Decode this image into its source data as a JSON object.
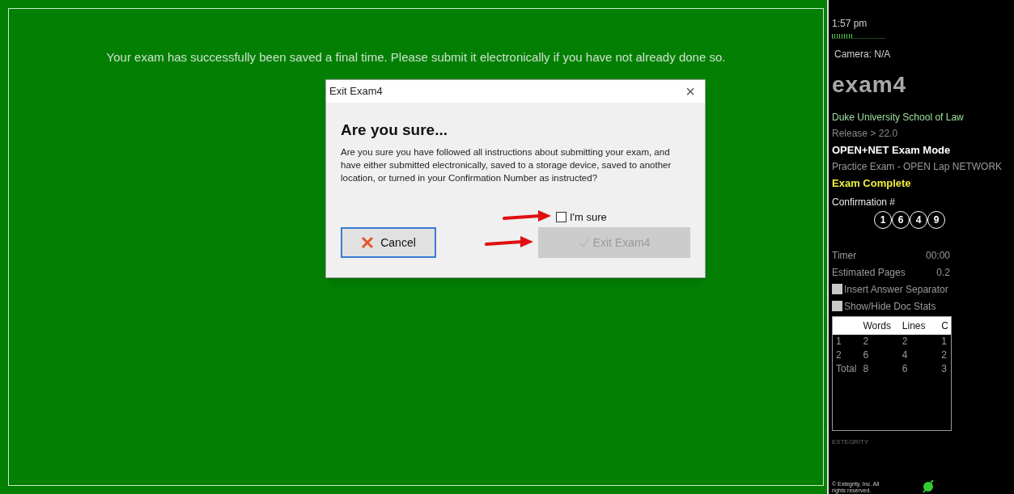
{
  "main": {
    "message": "Your exam has successfully been saved a final time. Please submit it electronically if you have not already done so."
  },
  "dialog": {
    "title": "Exit Exam4",
    "close": "×",
    "heading": "Are you sure...",
    "body": "Are you sure you have followed all instructions about submitting your exam, and have either submitted electronically, saved to a storage device, saved to another location, or turned in your Confirmation Number as instructed?",
    "confirm": {
      "label": "I'm sure",
      "checked": false
    },
    "buttons": [
      {
        "kind": "cancel",
        "label": "Cancel"
      },
      {
        "kind": "exit",
        "label": "Exit Exam4",
        "disabled": true
      }
    ]
  },
  "sidebar": {
    "time": "1:57 pm",
    "meter": {
      "level": 0.4
    },
    "camera": "Camera: N/A",
    "logo": "exam4",
    "school": "Duke University School of Law",
    "release": "Release > 22.0",
    "mode": "OPEN+NET Exam Mode",
    "exam": "Practice Exam - OPEN Lap NETWORK",
    "status": "Exam Complete",
    "confirmation_label": "Confirmation #",
    "confirmation_digits": [
      "1",
      "6",
      "4",
      "9"
    ],
    "stats": [
      {
        "label": "Timer",
        "value": "00:00"
      },
      {
        "label": "Estimated Pages",
        "value": "0.2"
      }
    ],
    "options": [
      {
        "label": "Insert Answer Separator",
        "checked": false
      },
      {
        "label": "Show/Hide Doc Stats",
        "checked": false
      }
    ],
    "table": {
      "columns": [
        "",
        "Words",
        "Lines",
        "C"
      ],
      "rows": [
        [
          "1",
          "2",
          "2",
          "1"
        ],
        [
          "2",
          "6",
          "4",
          "2"
        ],
        [
          "Total",
          "8",
          "6",
          "3"
        ]
      ]
    },
    "brand": "EXTEGRITY",
    "copyright": "© Extegrity, Inc. All rights reserved."
  }
}
